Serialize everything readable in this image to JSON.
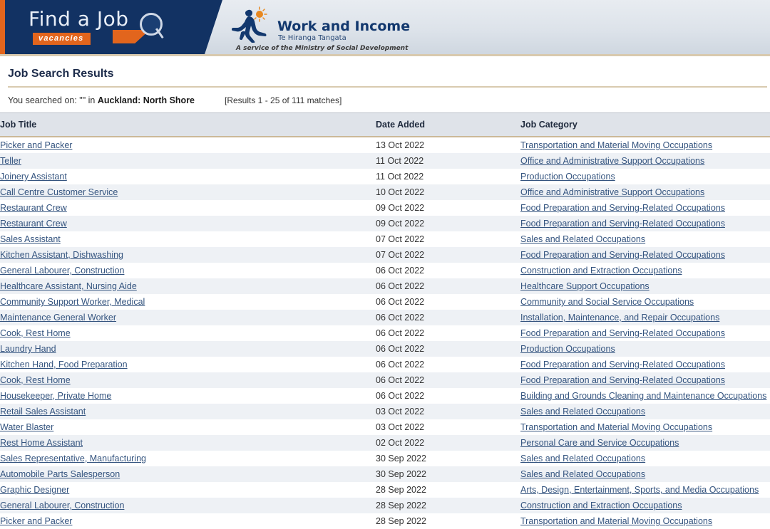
{
  "banner": {
    "find_a_job": {
      "wordmark": "Find a Job",
      "tagline": "vacancies"
    },
    "work_and_income": {
      "title": "Work and Income",
      "maori_name": "Te Hiranga Tangata",
      "footer": "A service of the Ministry of Social Development"
    }
  },
  "page": {
    "title": "Job Search Results",
    "searched_prefix": "You searched on: \"\" in ",
    "searched_criteria": "Auckland: North Shore",
    "results_count": "[Results 1 - 25 of 111 matches]"
  },
  "table": {
    "columns": [
      "Job Title",
      "Date Added",
      "Job Category"
    ],
    "rows": [
      {
        "title": "Picker and Packer",
        "date": "13 Oct 2022",
        "category": "Transportation and Material Moving Occupations"
      },
      {
        "title": "Teller",
        "date": "11 Oct 2022",
        "category": "Office and Administrative Support Occupations"
      },
      {
        "title": "Joinery Assistant",
        "date": "11 Oct 2022",
        "category": "Production Occupations"
      },
      {
        "title": "Call Centre Customer Service",
        "date": "10 Oct 2022",
        "category": "Office and Administrative Support Occupations"
      },
      {
        "title": "Restaurant Crew",
        "date": "09 Oct 2022",
        "category": "Food Preparation and Serving-Related Occupations"
      },
      {
        "title": "Restaurant Crew",
        "date": "09 Oct 2022",
        "category": "Food Preparation and Serving-Related Occupations"
      },
      {
        "title": "Sales Assistant",
        "date": "07 Oct 2022",
        "category": "Sales and Related Occupations"
      },
      {
        "title": "Kitchen Assistant, Dishwashing",
        "date": "07 Oct 2022",
        "category": "Food Preparation and Serving-Related Occupations"
      },
      {
        "title": "General Labourer, Construction",
        "date": "06 Oct 2022",
        "category": "Construction and Extraction Occupations"
      },
      {
        "title": "Healthcare Assistant, Nursing Aide",
        "date": "06 Oct 2022",
        "category": "Healthcare Support Occupations"
      },
      {
        "title": "Community Support Worker, Medical",
        "date": "06 Oct 2022",
        "category": "Community and Social Service Occupations"
      },
      {
        "title": "Maintenance General Worker",
        "date": "06 Oct 2022",
        "category": "Installation, Maintenance, and Repair Occupations"
      },
      {
        "title": "Cook, Rest Home",
        "date": "06 Oct 2022",
        "category": "Food Preparation and Serving-Related Occupations"
      },
      {
        "title": "Laundry Hand",
        "date": "06 Oct 2022",
        "category": "Production Occupations"
      },
      {
        "title": "Kitchen Hand, Food Preparation",
        "date": "06 Oct 2022",
        "category": "Food Preparation and Serving-Related Occupations"
      },
      {
        "title": "Cook, Rest Home",
        "date": "06 Oct 2022",
        "category": "Food Preparation and Serving-Related Occupations"
      },
      {
        "title": "Housekeeper, Private Home",
        "date": "06 Oct 2022",
        "category": "Building and Grounds Cleaning and Maintenance Occupations"
      },
      {
        "title": "Retail Sales Assistant",
        "date": "03 Oct 2022",
        "category": "Sales and Related Occupations"
      },
      {
        "title": "Water Blaster",
        "date": "03 Oct 2022",
        "category": "Transportation and Material Moving Occupations"
      },
      {
        "title": "Rest Home Assistant",
        "date": "02 Oct 2022",
        "category": "Personal Care and Service Occupations"
      },
      {
        "title": "Sales Representative, Manufacturing",
        "date": "30 Sep 2022",
        "category": "Sales and Related Occupations"
      },
      {
        "title": "Automobile Parts Salesperson",
        "date": "30 Sep 2022",
        "category": "Sales and Related Occupations"
      },
      {
        "title": "Graphic Designer",
        "date": "28 Sep 2022",
        "category": "Arts, Design, Entertainment, Sports, and Media Occupations"
      },
      {
        "title": "General Labourer, Construction",
        "date": "28 Sep 2022",
        "category": "Construction and Extraction Occupations"
      },
      {
        "title": "Picker and Packer",
        "date": "28 Sep 2022",
        "category": "Transportation and Material Moving Occupations"
      }
    ]
  },
  "colors": {
    "navy": "#123263",
    "orange": "#e2651d",
    "link": "#34547f",
    "header_band": "#dfe3e9",
    "row_alt": "#eef1f5",
    "rule_tan": "#d9cbb0"
  }
}
